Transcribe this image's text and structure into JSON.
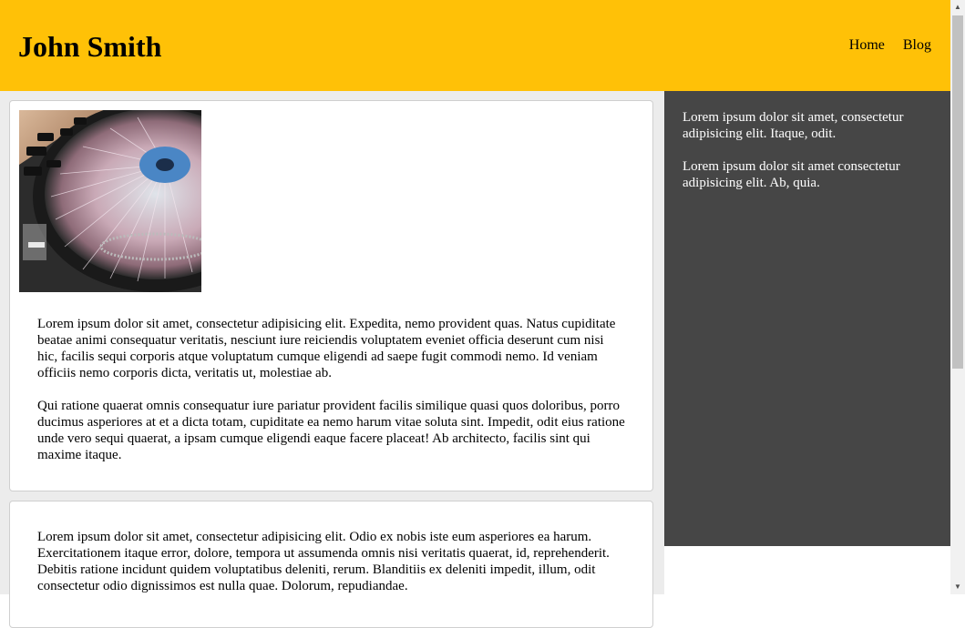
{
  "header": {
    "title": "John Smith",
    "nav": [
      "Home",
      "Blog"
    ],
    "background": "#ffc107"
  },
  "main": {
    "image": {
      "icon": "turntable-photo"
    },
    "card1_paragraphs": [
      "Lorem ipsum dolor sit amet, consectetur adipisicing elit. Expedita, nemo provident quas. Natus cupiditate beatae animi consequatur veritatis, nesciunt iure reiciendis voluptatem eveniet officia deserunt cum nisi hic, facilis sequi corporis atque voluptatum cumque eligendi ad saepe fugit commodi nemo. Id veniam officiis nemo corporis dicta, veritatis ut, molestiae ab.",
      "Qui ratione quaerat omnis consequatur iure pariatur provident facilis similique quasi quos doloribus, porro ducimus asperiores at et a dicta totam, cupiditate ea nemo harum vitae soluta sint. Impedit, odit eius ratione unde vero sequi quaerat, a ipsam cumque eligendi eaque facere placeat! Ab architecto, facilis sint qui maxime itaque."
    ],
    "card2_paragraphs": [
      "Lorem ipsum dolor sit amet, consectetur adipisicing elit. Odio ex nobis iste eum asperiores ea harum. Exercitationem itaque error, dolore, tempora ut assumenda omnis nisi veritatis quaerat, id, reprehenderit. Debitis ratione incidunt quidem voluptatibus deleniti, rerum. Blanditiis ex deleniti impedit, illum, odit consectetur odio dignissimos est nulla quae. Dolorum, repudiandae."
    ]
  },
  "sidebar": {
    "paragraphs": [
      "Lorem ipsum dolor sit amet, consectetur adipisicing elit. Itaque, odit.",
      "Lorem ipsum dolor sit amet consectetur adipisicing elit. Ab, quia."
    ],
    "background": "#464646"
  },
  "scrollbar": {
    "up_icon": "scroll-up-arrow-icon",
    "down_icon": "scroll-down-arrow-icon"
  }
}
